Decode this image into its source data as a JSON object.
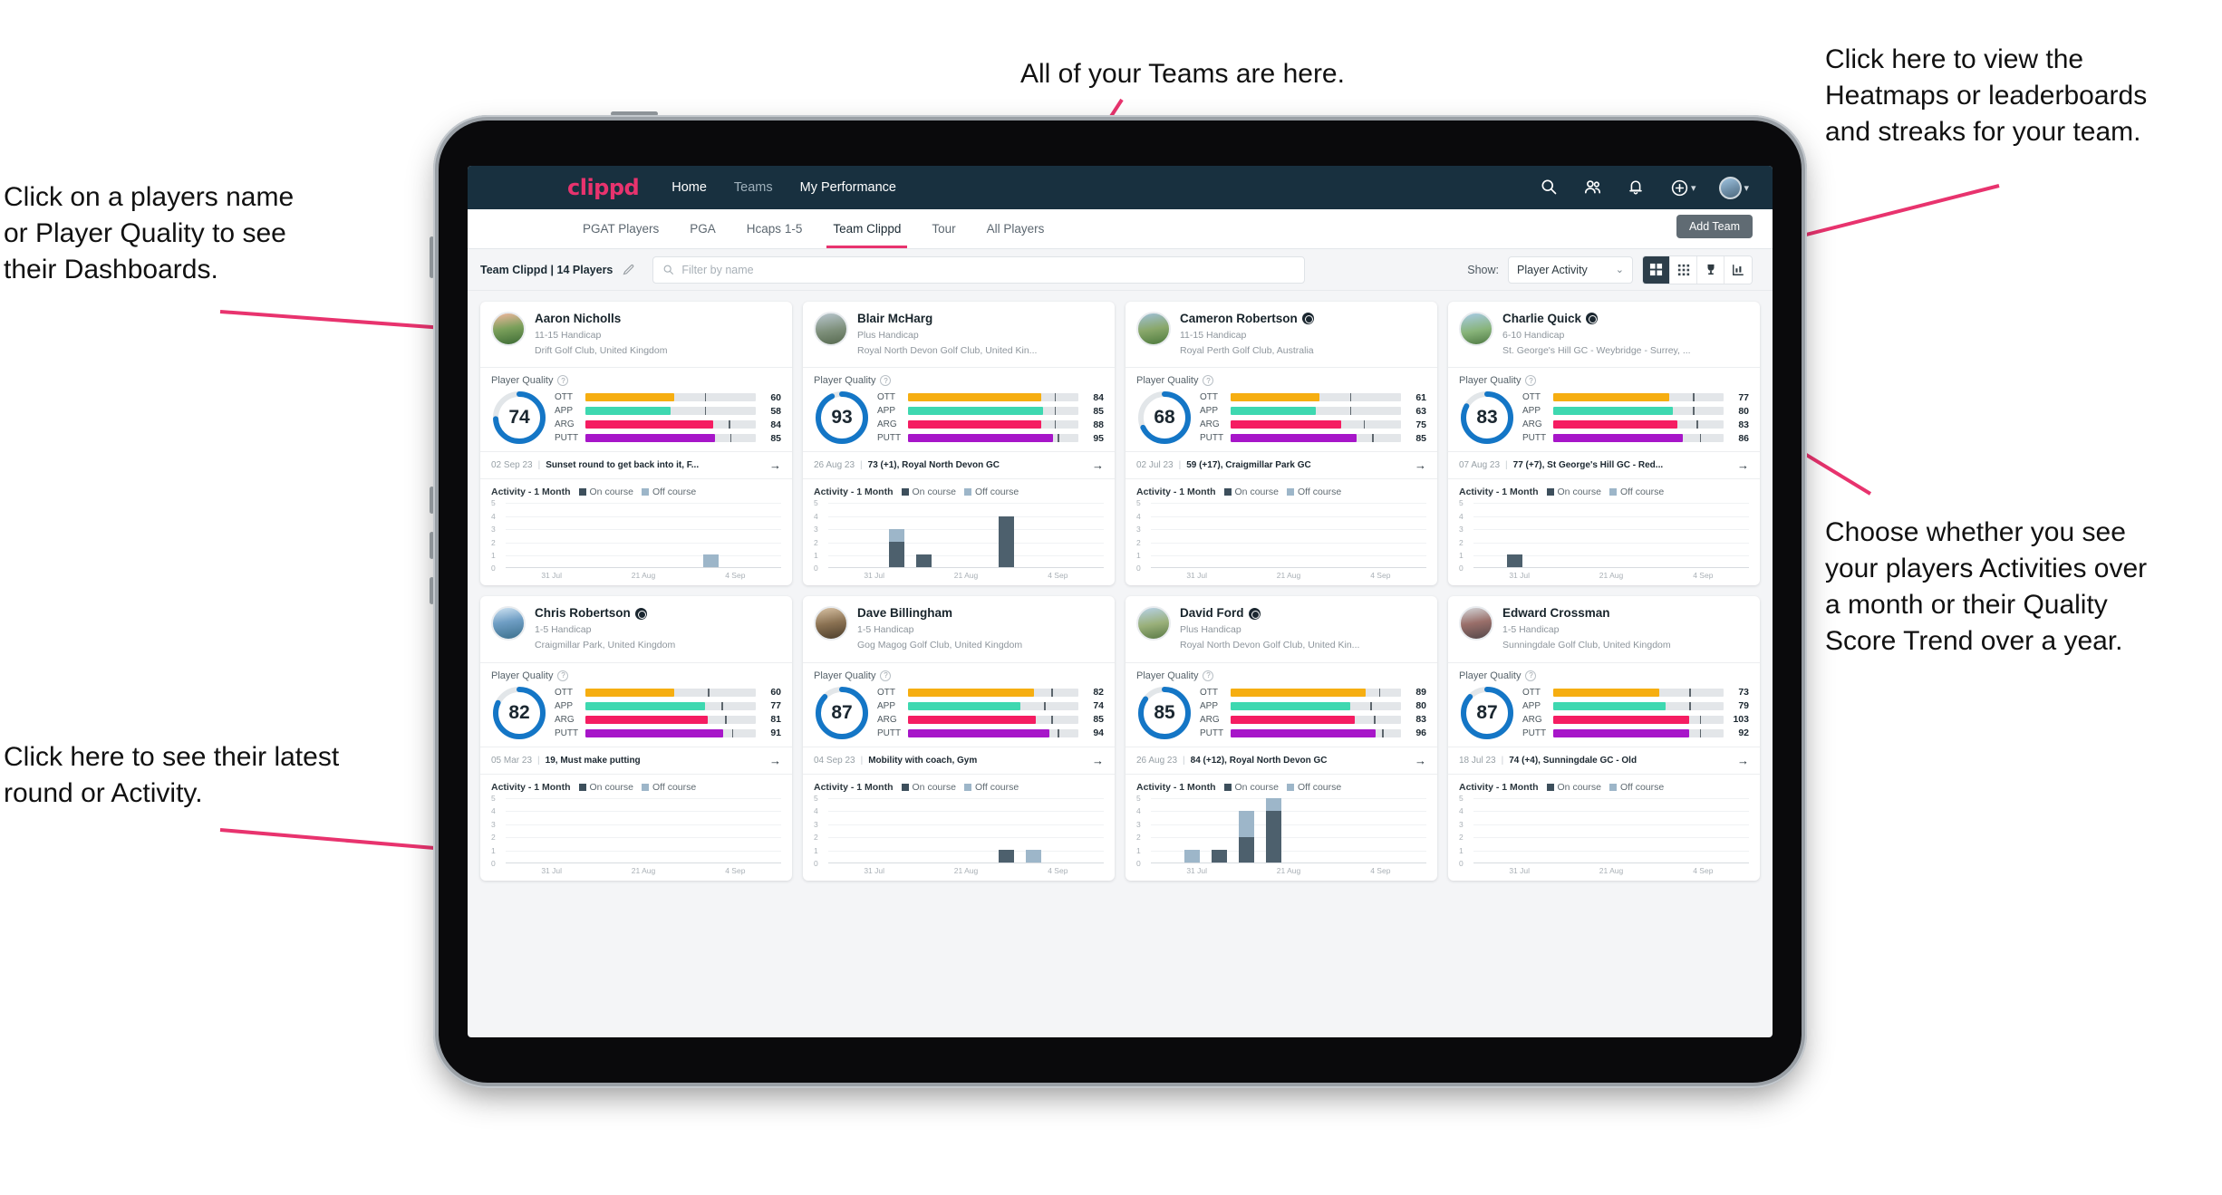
{
  "annotations": [
    {
      "id": "players-name",
      "text": "Click on a players name\nor Player Quality to see\ntheir Dashboards."
    },
    {
      "id": "teams-here",
      "text": "All of your Teams are here."
    },
    {
      "id": "heatmaps",
      "text": "Click here to view the\nHeatmaps or leaderboards\nand streaks for your team."
    },
    {
      "id": "activity-choice",
      "text": "Choose whether you see\nyour players Activities over\na month or their Quality\nScore Trend over a year."
    },
    {
      "id": "latest-round",
      "text": "Click here to see their latest\nround or Activity."
    }
  ],
  "colors": {
    "accent_pink": "#e8336e",
    "nav_dark": "#18303f",
    "ring_blue": "#1476c6",
    "ott": "#f6ae11",
    "app": "#3ed8b0",
    "arg": "#f51d62",
    "putt": "#a716c9",
    "on_course": "#4d606d",
    "off_course": "#9db6c9"
  },
  "topnav": {
    "brand": "clippd",
    "links": [
      {
        "label": "Home",
        "active": true
      },
      {
        "label": "Teams",
        "active": false
      },
      {
        "label": "My Performance",
        "active": true
      }
    ],
    "icons": [
      "search-icon",
      "people-icon",
      "bell-icon",
      "plus-circle-icon",
      "avatar"
    ]
  },
  "subnav": {
    "tabs": [
      {
        "label": "PGAT Players",
        "active": false
      },
      {
        "label": "PGA",
        "active": false
      },
      {
        "label": "Hcaps 1-5",
        "active": false
      },
      {
        "label": "Team Clippd",
        "active": true
      },
      {
        "label": "Tour",
        "active": false
      },
      {
        "label": "All Players",
        "active": false
      }
    ],
    "add_team_label": "Add Team"
  },
  "filterbar": {
    "team_label": "Team Clippd | 14 Players",
    "edit_icon": "pencil-icon",
    "search_placeholder": "Filter by name",
    "search_value": "",
    "show_label": "Show:",
    "show_value": "Player Activity",
    "view_buttons": [
      "card-view-icon",
      "grid-view-icon",
      "trophy-icon",
      "streak-icon"
    ],
    "selected_view": "card-view-icon"
  },
  "card_labels": {
    "player_quality": "Player Quality",
    "activity_title": "Activity - 1 Month",
    "legend_on": "On course",
    "legend_off": "Off course",
    "metric_labels": [
      "OTT",
      "APP",
      "ARG",
      "PUTT"
    ],
    "y_ticks": [
      "5",
      "4",
      "3",
      "2",
      "1",
      "0"
    ],
    "x_ticks": [
      "31 Jul",
      "21 Aug",
      "4 Sep"
    ]
  },
  "players": [
    {
      "name": "Aaron Nicholls",
      "verified": false,
      "handicap": "11-15 Handicap",
      "club": "Drift Golf Club, United Kingdom",
      "quality": 74,
      "metrics": [
        {
          "label": "OTT",
          "value": 60,
          "fill": 52,
          "mark": 70
        },
        {
          "label": "APP",
          "value": 58,
          "fill": 50,
          "mark": 70
        },
        {
          "label": "ARG",
          "value": 84,
          "fill": 75,
          "mark": 84
        },
        {
          "label": "PUTT",
          "value": 85,
          "fill": 76,
          "mark": 85
        }
      ],
      "round": {
        "date": "02 Sep 23",
        "text": "Sunset round to get back into it, F..."
      },
      "activity": [
        0,
        0,
        0,
        0,
        0,
        0,
        0,
        1,
        0,
        0
      ]
    },
    {
      "name": "Blair McHarg",
      "verified": false,
      "handicap": "Plus Handicap",
      "club": "Royal North Devon Golf Club, United Kin...",
      "quality": 93,
      "metrics": [
        {
          "label": "OTT",
          "value": 84,
          "fill": 78,
          "mark": 86
        },
        {
          "label": "APP",
          "value": 85,
          "fill": 79,
          "mark": 86
        },
        {
          "label": "ARG",
          "value": 88,
          "fill": 78,
          "mark": 86
        },
        {
          "label": "PUTT",
          "value": 95,
          "fill": 85,
          "mark": 88
        }
      ],
      "round": {
        "date": "26 Aug 23",
        "text": "73 (+1), Royal North Devon GC"
      },
      "activity_stacked": [
        {
          "on": 0,
          "off": 0
        },
        {
          "on": 0,
          "off": 0
        },
        {
          "on": 2,
          "off": 1
        },
        {
          "on": 1,
          "off": 0
        },
        {
          "on": 0,
          "off": 0
        },
        {
          "on": 0,
          "off": 0
        },
        {
          "on": 4,
          "off": 0
        },
        {
          "on": 0,
          "off": 0
        },
        {
          "on": 0,
          "off": 0
        },
        {
          "on": 0,
          "off": 0
        }
      ]
    },
    {
      "name": "Cameron Robertson",
      "verified": true,
      "handicap": "11-15 Handicap",
      "club": "Royal Perth Golf Club, Australia",
      "quality": 68,
      "metrics": [
        {
          "label": "OTT",
          "value": 61,
          "fill": 52,
          "mark": 70
        },
        {
          "label": "APP",
          "value": 63,
          "fill": 50,
          "mark": 70
        },
        {
          "label": "ARG",
          "value": 75,
          "fill": 65,
          "mark": 78
        },
        {
          "label": "PUTT",
          "value": 85,
          "fill": 74,
          "mark": 83
        }
      ],
      "round": {
        "date": "02 Jul 23",
        "text": "59 (+17), Craigmillar Park GC"
      },
      "activity": [
        0,
        0,
        0,
        0,
        0,
        0,
        0,
        0,
        0,
        0
      ]
    },
    {
      "name": "Charlie Quick",
      "verified": true,
      "handicap": "6-10 Handicap",
      "club": "St. George's Hill GC - Weybridge - Surrey, ...",
      "quality": 83,
      "metrics": [
        {
          "label": "OTT",
          "value": 77,
          "fill": 68,
          "mark": 82
        },
        {
          "label": "APP",
          "value": 80,
          "fill": 70,
          "mark": 82
        },
        {
          "label": "ARG",
          "value": 83,
          "fill": 73,
          "mark": 84
        },
        {
          "label": "PUTT",
          "value": 86,
          "fill": 76,
          "mark": 86
        }
      ],
      "round": {
        "date": "07 Aug 23",
        "text": "77 (+7), St George's Hill GC - Red..."
      },
      "activity_stacked": [
        {
          "on": 0,
          "off": 0
        },
        {
          "on": 1,
          "off": 0
        },
        {
          "on": 0,
          "off": 0
        },
        {
          "on": 0,
          "off": 0
        },
        {
          "on": 0,
          "off": 0
        },
        {
          "on": 0,
          "off": 0
        },
        {
          "on": 0,
          "off": 0
        },
        {
          "on": 0,
          "off": 0
        },
        {
          "on": 0,
          "off": 0
        },
        {
          "on": 0,
          "off": 0
        }
      ]
    },
    {
      "name": "Chris Robertson",
      "verified": true,
      "handicap": "1-5 Handicap",
      "club": "Craigmillar Park, United Kingdom",
      "quality": 82,
      "metrics": [
        {
          "label": "OTT",
          "value": 60,
          "fill": 52,
          "mark": 72
        },
        {
          "label": "APP",
          "value": 77,
          "fill": 70,
          "mark": 80
        },
        {
          "label": "ARG",
          "value": 81,
          "fill": 72,
          "mark": 82
        },
        {
          "label": "PUTT",
          "value": 91,
          "fill": 81,
          "mark": 86
        }
      ],
      "round": {
        "date": "05 Mar 23",
        "text": "19, Must make putting"
      },
      "activity_stacked": [
        {
          "on": 0,
          "off": 0
        },
        {
          "on": 0,
          "off": 0
        },
        {
          "on": 0,
          "off": 0
        },
        {
          "on": 0,
          "off": 0
        },
        {
          "on": 0,
          "off": 0
        },
        {
          "on": 0,
          "off": 0
        },
        {
          "on": 0,
          "off": 0
        },
        {
          "on": 0,
          "off": 0
        },
        {
          "on": 0,
          "off": 0
        },
        {
          "on": 0,
          "off": 0
        }
      ]
    },
    {
      "name": "Dave Billingham",
      "verified": false,
      "handicap": "1-5 Handicap",
      "club": "Gog Magog Golf Club, United Kingdom",
      "quality": 87,
      "metrics": [
        {
          "label": "OTT",
          "value": 82,
          "fill": 74,
          "mark": 84
        },
        {
          "label": "APP",
          "value": 74,
          "fill": 66,
          "mark": 80
        },
        {
          "label": "ARG",
          "value": 85,
          "fill": 75,
          "mark": 84
        },
        {
          "label": "PUTT",
          "value": 94,
          "fill": 83,
          "mark": 88
        }
      ],
      "round": {
        "date": "04 Sep 23",
        "text": "Mobility with coach, Gym"
      },
      "activity_stacked": [
        {
          "on": 0,
          "off": 0
        },
        {
          "on": 0,
          "off": 0
        },
        {
          "on": 0,
          "off": 0
        },
        {
          "on": 0,
          "off": 0
        },
        {
          "on": 0,
          "off": 0
        },
        {
          "on": 0,
          "off": 0
        },
        {
          "on": 1,
          "off": 0
        },
        {
          "on": 0,
          "off": 1
        },
        {
          "on": 0,
          "off": 0
        },
        {
          "on": 0,
          "off": 0
        }
      ]
    },
    {
      "name": "David Ford",
      "verified": true,
      "handicap": "Plus Handicap",
      "club": "Royal North Devon Golf Club, United Kin...",
      "quality": 85,
      "metrics": [
        {
          "label": "OTT",
          "value": 89,
          "fill": 79,
          "mark": 87
        },
        {
          "label": "APP",
          "value": 80,
          "fill": 70,
          "mark": 82
        },
        {
          "label": "ARG",
          "value": 83,
          "fill": 73,
          "mark": 84
        },
        {
          "label": "PUTT",
          "value": 96,
          "fill": 85,
          "mark": 89
        }
      ],
      "round": {
        "date": "26 Aug 23",
        "text": "84 (+12), Royal North Devon GC"
      },
      "activity_stacked": [
        {
          "on": 0,
          "off": 0
        },
        {
          "on": 0,
          "off": 1
        },
        {
          "on": 1,
          "off": 0
        },
        {
          "on": 2,
          "off": 2
        },
        {
          "on": 4,
          "off": 1
        },
        {
          "on": 0,
          "off": 0
        },
        {
          "on": 0,
          "off": 0
        },
        {
          "on": 0,
          "off": 0
        },
        {
          "on": 0,
          "off": 0
        },
        {
          "on": 0,
          "off": 0
        }
      ]
    },
    {
      "name": "Edward Crossman",
      "verified": false,
      "handicap": "1-5 Handicap",
      "club": "Sunningdale Golf Club, United Kingdom",
      "quality": 87,
      "metrics": [
        {
          "label": "OTT",
          "value": 73,
          "fill": 62,
          "mark": 80
        },
        {
          "label": "APP",
          "value": 79,
          "fill": 66,
          "mark": 80
        },
        {
          "label": "ARG",
          "value": 103,
          "fill": 80,
          "mark": 86
        },
        {
          "label": "PUTT",
          "value": 92,
          "fill": 80,
          "mark": 86
        }
      ],
      "round": {
        "date": "18 Jul 23",
        "text": "74 (+4), Sunningdale GC - Old"
      },
      "activity_stacked": [
        {
          "on": 0,
          "off": 0
        },
        {
          "on": 0,
          "off": 0
        },
        {
          "on": 0,
          "off": 0
        },
        {
          "on": 0,
          "off": 0
        },
        {
          "on": 0,
          "off": 0
        },
        {
          "on": 0,
          "off": 0
        },
        {
          "on": 0,
          "off": 0
        },
        {
          "on": 0,
          "off": 0
        },
        {
          "on": 0,
          "off": 0
        },
        {
          "on": 0,
          "off": 0
        }
      ]
    }
  ]
}
